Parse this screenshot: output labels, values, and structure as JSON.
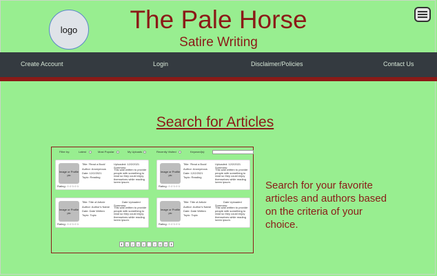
{
  "header": {
    "logo_text": "logo",
    "title": "The Pale Horse",
    "subtitle": "Satire Writing",
    "menu_icon": "hamburger-menu-icon"
  },
  "nav": {
    "items": [
      {
        "label": "Create Account"
      },
      {
        "label": "Login"
      },
      {
        "label": "Disclaimer/Policies"
      },
      {
        "label": "Contact Us"
      }
    ]
  },
  "colors": {
    "background": "#98ee90",
    "accent": "#8b1a17",
    "navbar": "#343a40"
  },
  "main": {
    "heading": "Search for Articles",
    "description": "Search for your favorite articles and authors based on the criteria of your choice."
  },
  "filters": {
    "filter_by": "Filter by:",
    "options": [
      "Latest",
      "Most Popular",
      "My Uploads",
      "Recently Visited"
    ],
    "keywords_label": "Keyword(s):"
  },
  "cards": [
    {
      "thumb": "Image or Profile pic",
      "title": "Title: 'Read a Book'",
      "uploaded": "Uploaded: 12/2/2021",
      "author": "Author: Anonymous",
      "date": "Date: 12/2/2021",
      "topic": "Topic: Reading",
      "summary_label": "Summary:",
      "summary": "This was written to provide people with something to read so they could enjoy themselves while reading lorem ipsum.",
      "rating": "Rating: ☆☆☆☆☆"
    },
    {
      "thumb": "Image or Profile pic",
      "title": "Title: 'Read a Book'",
      "uploaded": "Uploaded: 12/2/2021",
      "author": "Author: Anonymous",
      "date": "Date: 12/2/2021",
      "topic": "Topic: Reading",
      "summary_label": "Summary:",
      "summary": "This was written to provide people with something to read so they could enjoy themselves while reading lorem ipsum.",
      "rating": "Rating: ☆☆☆☆☆"
    },
    {
      "thumb": "Image or Profile pic",
      "title": "Title: Title of Article",
      "uploaded": "Date Uploaded",
      "author": "Author: Author's Name",
      "date": "Date: Date Written",
      "topic": "Topic: Topic",
      "summary_label": "Summary:",
      "summary": "This was written to provide people with something to read so they could enjoy themselves while reading lorem ipsum.",
      "rating": "Rating: ☆☆☆☆☆"
    },
    {
      "thumb": "Image or Profile pic",
      "title": "Title: Title of Article",
      "uploaded": "Date Uploaded",
      "author": "Author: Author's Name",
      "date": "Date: Date Written",
      "topic": "Topic: Topic",
      "summary_label": "Summary:",
      "summary": "This was written to provide people with something to read so they could enjoy themselves while reading lorem ipsum.",
      "rating": "Rating: ☆☆☆☆☆"
    }
  ],
  "pagination": {
    "prev": "‹",
    "pages": [
      "1",
      "2",
      "3",
      "4",
      "...",
      "7",
      "8",
      "9"
    ],
    "next": "›"
  }
}
